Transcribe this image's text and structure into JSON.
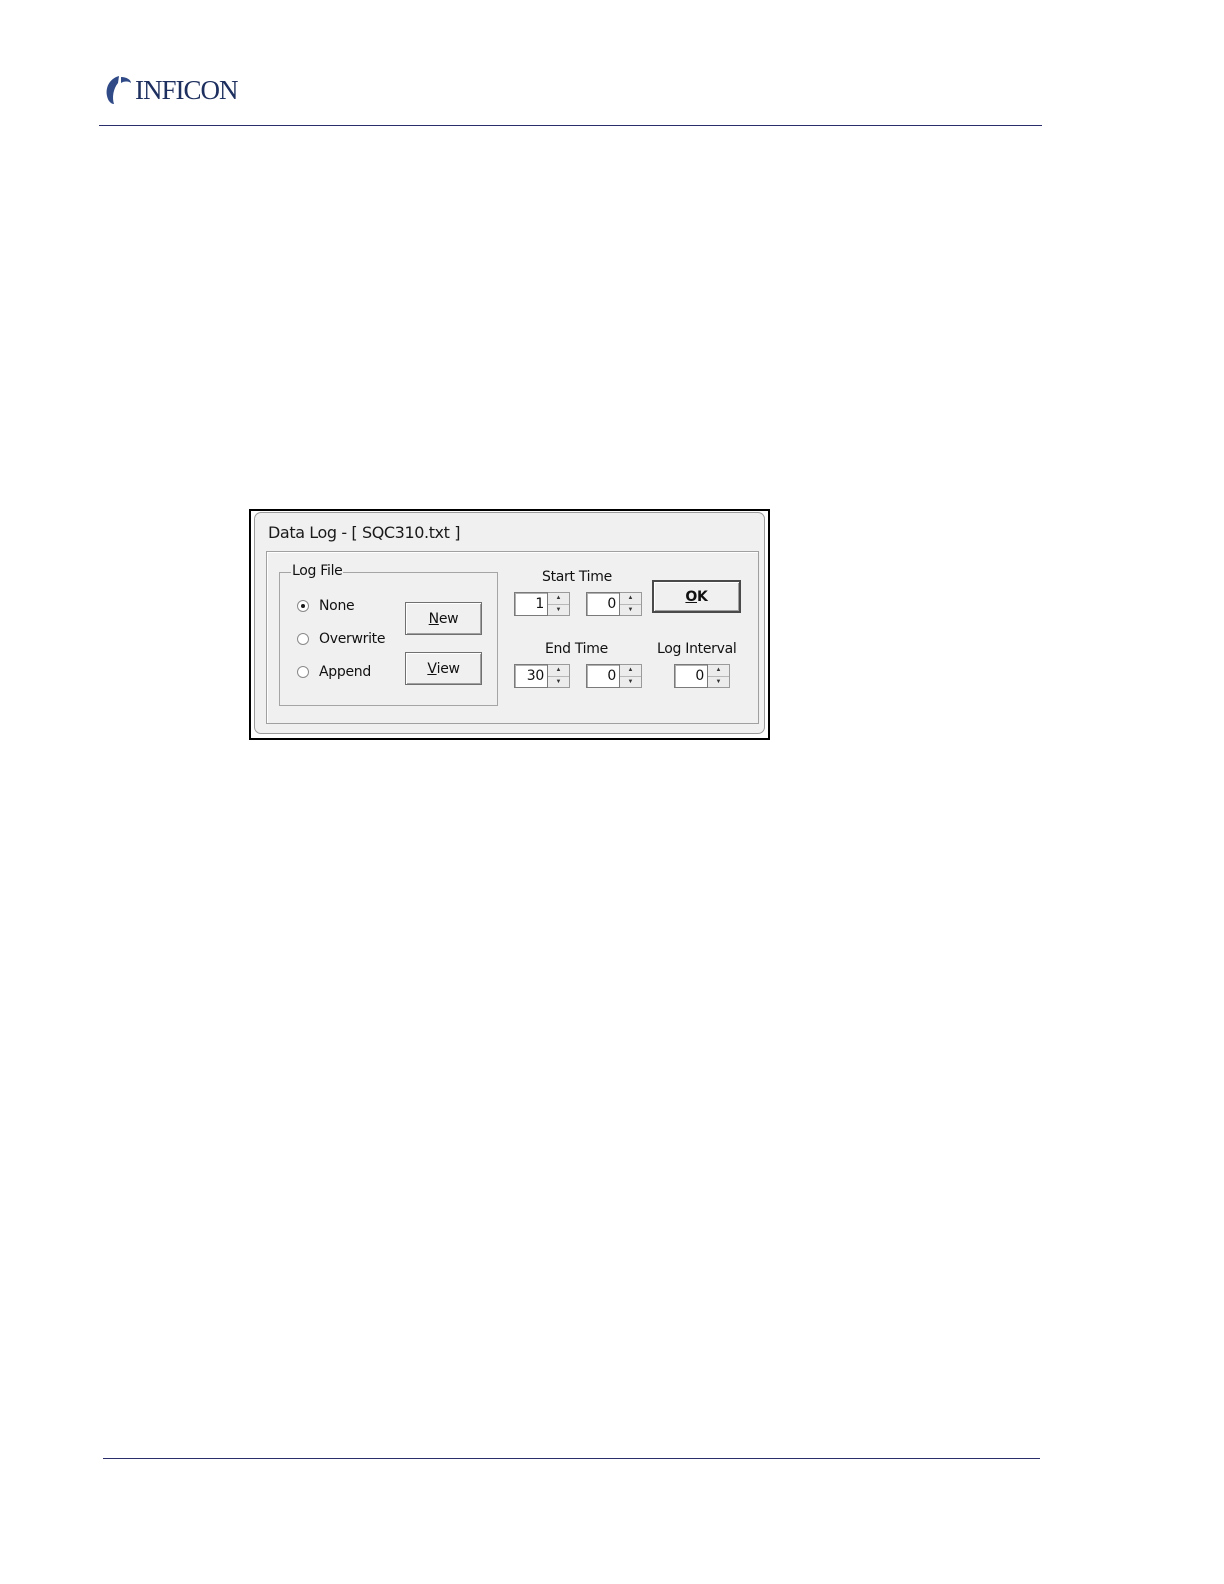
{
  "header": {
    "brand": "INFICON"
  },
  "dialog": {
    "title": "Data Log - [ SQC310.txt ]",
    "log_file": {
      "legend": "Log File",
      "options": [
        {
          "label": "None",
          "checked": true
        },
        {
          "label": "Overwrite",
          "checked": false
        },
        {
          "label": "Append",
          "checked": false
        }
      ],
      "new_button": {
        "mnemonic": "N",
        "rest": "ew"
      },
      "view_button": {
        "mnemonic": "V",
        "rest": "iew"
      }
    },
    "start_time": {
      "label": "Start Time",
      "value_a": "1",
      "value_b": "0"
    },
    "end_time": {
      "label": "End Time",
      "value_a": "30",
      "value_b": "0"
    },
    "log_interval": {
      "label": "Log Interval",
      "value": "0"
    },
    "ok_button": {
      "mnemonic": "O",
      "rest": "K"
    }
  },
  "icons": {
    "spin_up": "spin-up-icon",
    "spin_down": "spin-down-icon",
    "logo": "inficon-logo-icon"
  },
  "colors": {
    "brand": "#2a3f7a",
    "rule": "#2a2f6b",
    "dialog_bg": "#f0f0f0"
  }
}
